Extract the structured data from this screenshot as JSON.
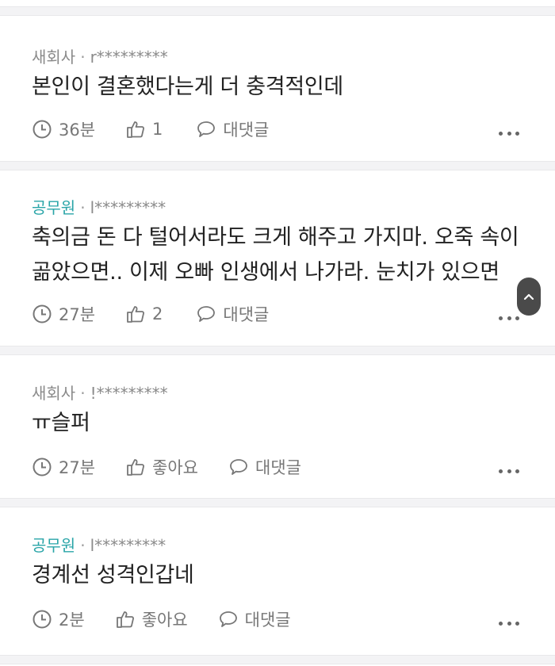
{
  "comments": [
    {
      "job": "새회사",
      "separator": "·",
      "user": "r*********",
      "text_lines": [
        "본인이 결혼했다는게 더 충격적인데"
      ],
      "time": "36분",
      "likes": "1",
      "reply_label": "대댓글"
    },
    {
      "job": "공무원",
      "separator": "·",
      "user": "l*********",
      "text_lines": [
        "축의금 돈 다 털어서라도 크게 해주고 가지마. 오죽 속이",
        "곪았으면.. 이제 오빠 인생에서 나가라. 눈치가 있으면"
      ],
      "time": "27분",
      "likes": "2",
      "reply_label": "대댓글"
    },
    {
      "job": "새회사",
      "separator": "·",
      "user": "!*********",
      "text_lines": [
        "ㅠ슬퍼"
      ],
      "time": "27분",
      "likes": "좋아요",
      "reply_label": "대댓글"
    },
    {
      "job": "공무원",
      "separator": "·",
      "user": "l*********",
      "text_lines": [
        "경계선 성격인갑네"
      ],
      "time": "2분",
      "likes": "좋아요",
      "reply_label": "대댓글"
    }
  ],
  "colors": {
    "job_highlight": "#2aa5a8",
    "meta": "#8a8a8a",
    "text": "#222222",
    "separator": "#f3f3f5"
  },
  "icons": {
    "time": "clock-icon",
    "like": "thumbs-up-icon",
    "reply": "speech-bubble-icon",
    "more": "more-dots-icon",
    "scroll": "chevron-up-icon"
  }
}
